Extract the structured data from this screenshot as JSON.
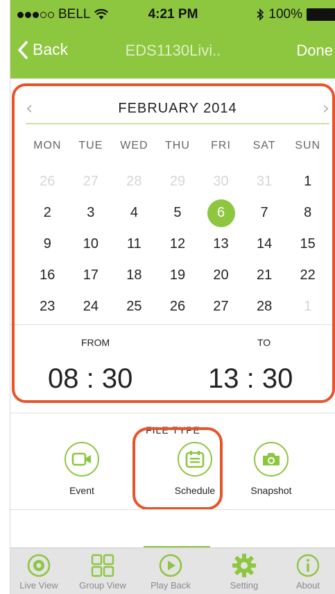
{
  "status_bar": {
    "carrier": "BELL",
    "time": "4:21 PM",
    "battery": "100%",
    "icons": [
      "signal-dots-icon",
      "wifi-icon",
      "bluetooth-icon",
      "battery-icon"
    ]
  },
  "nav": {
    "back_label": "Back",
    "title": "EDS1130Livi..",
    "done_label": "Done"
  },
  "calendar": {
    "month_label": "FEBRUARY 2014",
    "weekdays": [
      "MON",
      "TUE",
      "WED",
      "THU",
      "FRI",
      "SAT",
      "SUN"
    ],
    "weeks": [
      [
        {
          "d": "26",
          "muted": true
        },
        {
          "d": "27",
          "muted": true
        },
        {
          "d": "28",
          "muted": true
        },
        {
          "d": "29",
          "muted": true
        },
        {
          "d": "30",
          "muted": true
        },
        {
          "d": "31",
          "muted": true
        },
        {
          "d": "1"
        }
      ],
      [
        {
          "d": "2"
        },
        {
          "d": "3"
        },
        {
          "d": "4"
        },
        {
          "d": "5"
        },
        {
          "d": "6",
          "selected": true
        },
        {
          "d": "7"
        },
        {
          "d": "8"
        }
      ],
      [
        {
          "d": "9"
        },
        {
          "d": "10"
        },
        {
          "d": "11"
        },
        {
          "d": "12"
        },
        {
          "d": "13"
        },
        {
          "d": "14"
        },
        {
          "d": "15"
        }
      ],
      [
        {
          "d": "16"
        },
        {
          "d": "17"
        },
        {
          "d": "18"
        },
        {
          "d": "19"
        },
        {
          "d": "20"
        },
        {
          "d": "21"
        },
        {
          "d": "22"
        }
      ],
      [
        {
          "d": "23"
        },
        {
          "d": "24"
        },
        {
          "d": "25"
        },
        {
          "d": "26"
        },
        {
          "d": "27"
        },
        {
          "d": "28"
        },
        {
          "d": "1",
          "muted": true
        }
      ]
    ],
    "from_label": "FROM",
    "to_label": "TO",
    "from_time": "08 : 30",
    "to_time": "13 : 30"
  },
  "file_type": {
    "heading": "FILE TYPE",
    "items": [
      {
        "label": "Event",
        "icon": "video-camera-icon"
      },
      {
        "label": "Schedule",
        "icon": "calendar-icon"
      },
      {
        "label": "Snapshot",
        "icon": "camera-icon"
      }
    ]
  },
  "tabbar": {
    "items": [
      {
        "label": "Live View",
        "icon": "live-view-icon"
      },
      {
        "label": "Group View",
        "icon": "group-view-icon"
      },
      {
        "label": "Play Back",
        "icon": "play-back-icon",
        "active": true
      },
      {
        "label": "Setting",
        "icon": "gear-icon"
      },
      {
        "label": "About",
        "icon": "info-icon"
      }
    ]
  },
  "colors": {
    "accent": "#8dc63f",
    "highlight": "#e8542a",
    "muted_text": "#d6d6d6"
  }
}
